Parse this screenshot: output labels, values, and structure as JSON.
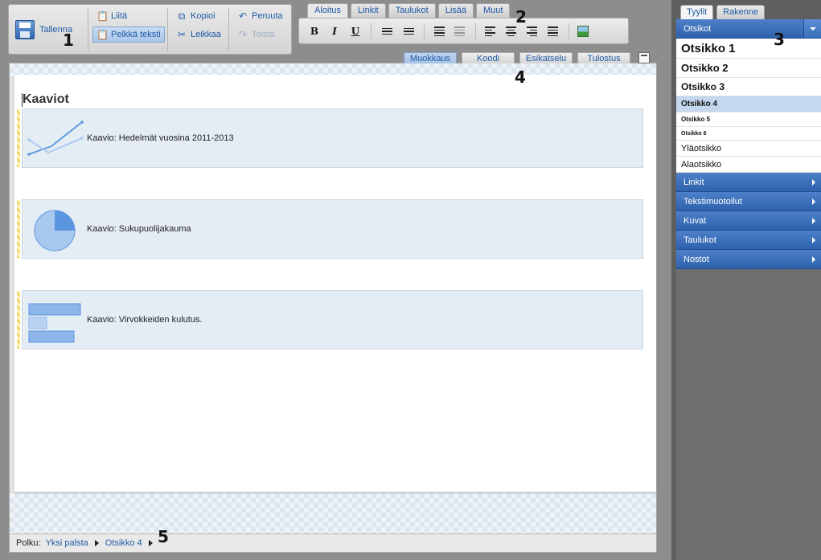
{
  "toolbar": {
    "save_label": "Tallenna",
    "paste_label": "Liitä",
    "paste_plain_label": "Pelkkä teksti",
    "copy_label": "Kopioi",
    "cut_label": "Leikkaa",
    "undo_label": "Peruuta",
    "redo_label": "Toista"
  },
  "ribbon": {
    "tabs": [
      {
        "label": "Aloitus"
      },
      {
        "label": "Linkit"
      },
      {
        "label": "Taulukot"
      },
      {
        "label": "Lisää"
      },
      {
        "label": "Muut"
      }
    ],
    "bold": "B",
    "italic": "I",
    "underline": "U"
  },
  "callouts": [
    "1",
    "2",
    "3",
    "4",
    "5"
  ],
  "editor": {
    "modes": [
      {
        "label": "Muokkaus"
      },
      {
        "label": "Koodi"
      },
      {
        "label": "Esikatselu"
      },
      {
        "label": "Tulostus"
      }
    ],
    "title": "Kaaviot",
    "blocks": [
      {
        "caption": "Kaavio: Hedelmät vuosina 2011-2013"
      },
      {
        "caption": "Kaavio: Sukupuolijakauma"
      },
      {
        "caption": "Kaavio: Virvokkeiden kulutus."
      }
    ],
    "path_label": "Polku:",
    "breadcrumbs": [
      {
        "label": "Yksi palsta"
      },
      {
        "label": "Otsikko 4"
      }
    ]
  },
  "panel": {
    "tabs": [
      {
        "label": "Tyylit"
      },
      {
        "label": "Rakenne"
      }
    ],
    "styles_header": "Otsikot",
    "styles": [
      {
        "label": "Otsikko 1"
      },
      {
        "label": "Otsikko 2"
      },
      {
        "label": "Otsikko 3"
      },
      {
        "label": "Otsikko 4"
      },
      {
        "label": "Otsikko 5"
      },
      {
        "label": "Otsikko 6"
      },
      {
        "label": "Yläotsikko"
      },
      {
        "label": "Alaotsikko"
      }
    ],
    "sections": [
      {
        "label": "Linkit"
      },
      {
        "label": "Tekstimuotoilut"
      },
      {
        "label": "Kuvat"
      },
      {
        "label": "Taulukot"
      },
      {
        "label": "Nostot"
      }
    ]
  },
  "colors": {
    "accent": "#2e62ad",
    "link": "#1f5aa6",
    "chart_block": "#e4ecf4",
    "chart_blue": "#5a96e0"
  }
}
